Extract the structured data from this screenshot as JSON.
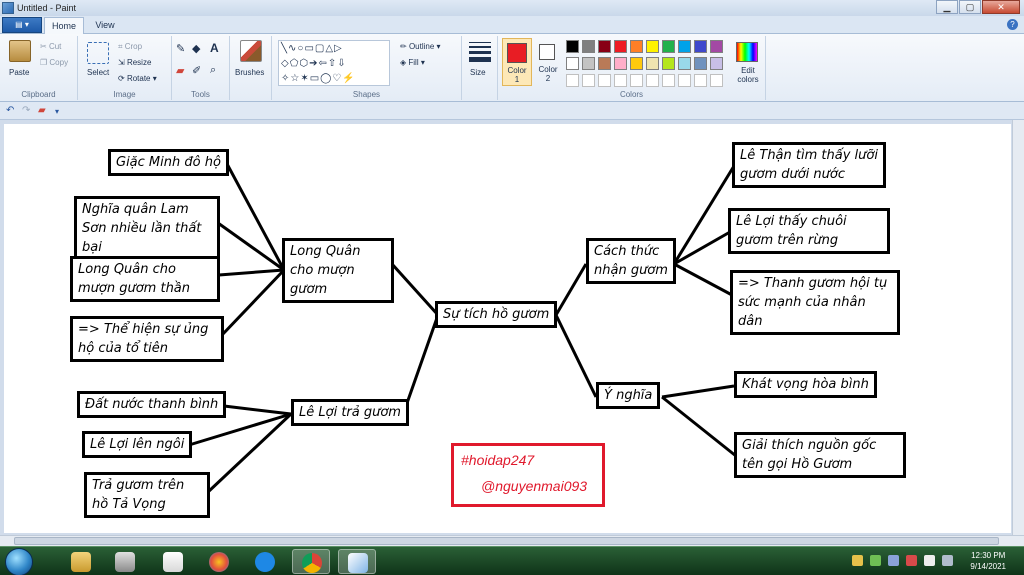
{
  "window": {
    "title": "Untitled - Paint",
    "controls": [
      "▁",
      "▢",
      "✕"
    ]
  },
  "tabs": {
    "file": "▤ ▾",
    "home": "Home",
    "view": "View",
    "help": "?"
  },
  "ribbon": {
    "clipboard": {
      "paste": "Paste",
      "cut": "Cut",
      "copy": "Copy",
      "label": "Clipboard"
    },
    "image": {
      "select": "Select",
      "crop": "Crop",
      "resize": "Resize",
      "rotate": "Rotate",
      "label": "Image"
    },
    "tools": {
      "label": "Tools"
    },
    "brushes": {
      "label": "Brushes"
    },
    "shapes": {
      "outline": "Outline",
      "fill": "Fill",
      "label": "Shapes"
    },
    "size": {
      "label": "Size"
    },
    "colors": {
      "color1": "Color 1",
      "color2": "Color 2",
      "edit": "Edit colors",
      "label": "Colors",
      "color1_value": "#e81d24",
      "color2_value": "#ffffff",
      "palette_row1": [
        "#000000",
        "#7f7f7f",
        "#880015",
        "#ed1c24",
        "#ff7f27",
        "#fff200",
        "#22b14c",
        "#00a2e8",
        "#3f48cc",
        "#a349a4"
      ],
      "palette_row2": [
        "#ffffff",
        "#c3c3c3",
        "#b97a57",
        "#ffaec9",
        "#ffc90e",
        "#efe4b0",
        "#b5e61d",
        "#99d9ea",
        "#7092be",
        "#c8bfe7"
      ]
    }
  },
  "mindmap": {
    "center": "Sự tích hồ gươm",
    "long_quan": "Long Quân cho mượn gươm",
    "giac_minh": "Giặc Minh đô hộ",
    "nghia_quan": "Nghĩa quân Lam Sơn nhiều lần thất bại",
    "long_quan_muon": "Long Quân cho mượn gươm thần",
    "the_hien": "=> Thể hiện sự ủng hộ của tổ tiên",
    "le_loi_tra": "Lê Lợi trả gươm",
    "dat_nuoc": "Đất nước thanh bình",
    "le_loi_len": "Lê Lợi lên ngôi",
    "tra_guom": "Trả gươm trên hồ Tả Vọng",
    "cach_thuc": "Cách thức nhận gươm",
    "le_than": "Lê Thận tìm thấy lưỡi gươm dưới nước",
    "le_loi_thay": "Lê Lợi thấy chuôi gươm trên rừng",
    "thanh_guom": "=> Thanh gươm hội tụ sức mạnh của nhân dân",
    "y_nghia": "Ý nghĩa",
    "khat_vong": "Khát vọng hòa bình",
    "giai_thich": "Giải thích nguồn gốc tên gọi Hồ Gươm"
  },
  "watermark": {
    "line1": "#hoidap247",
    "line2": "@nguyenmai093"
  },
  "taskbar": {
    "time": "12:30 PM",
    "date": "9/14/2021"
  }
}
